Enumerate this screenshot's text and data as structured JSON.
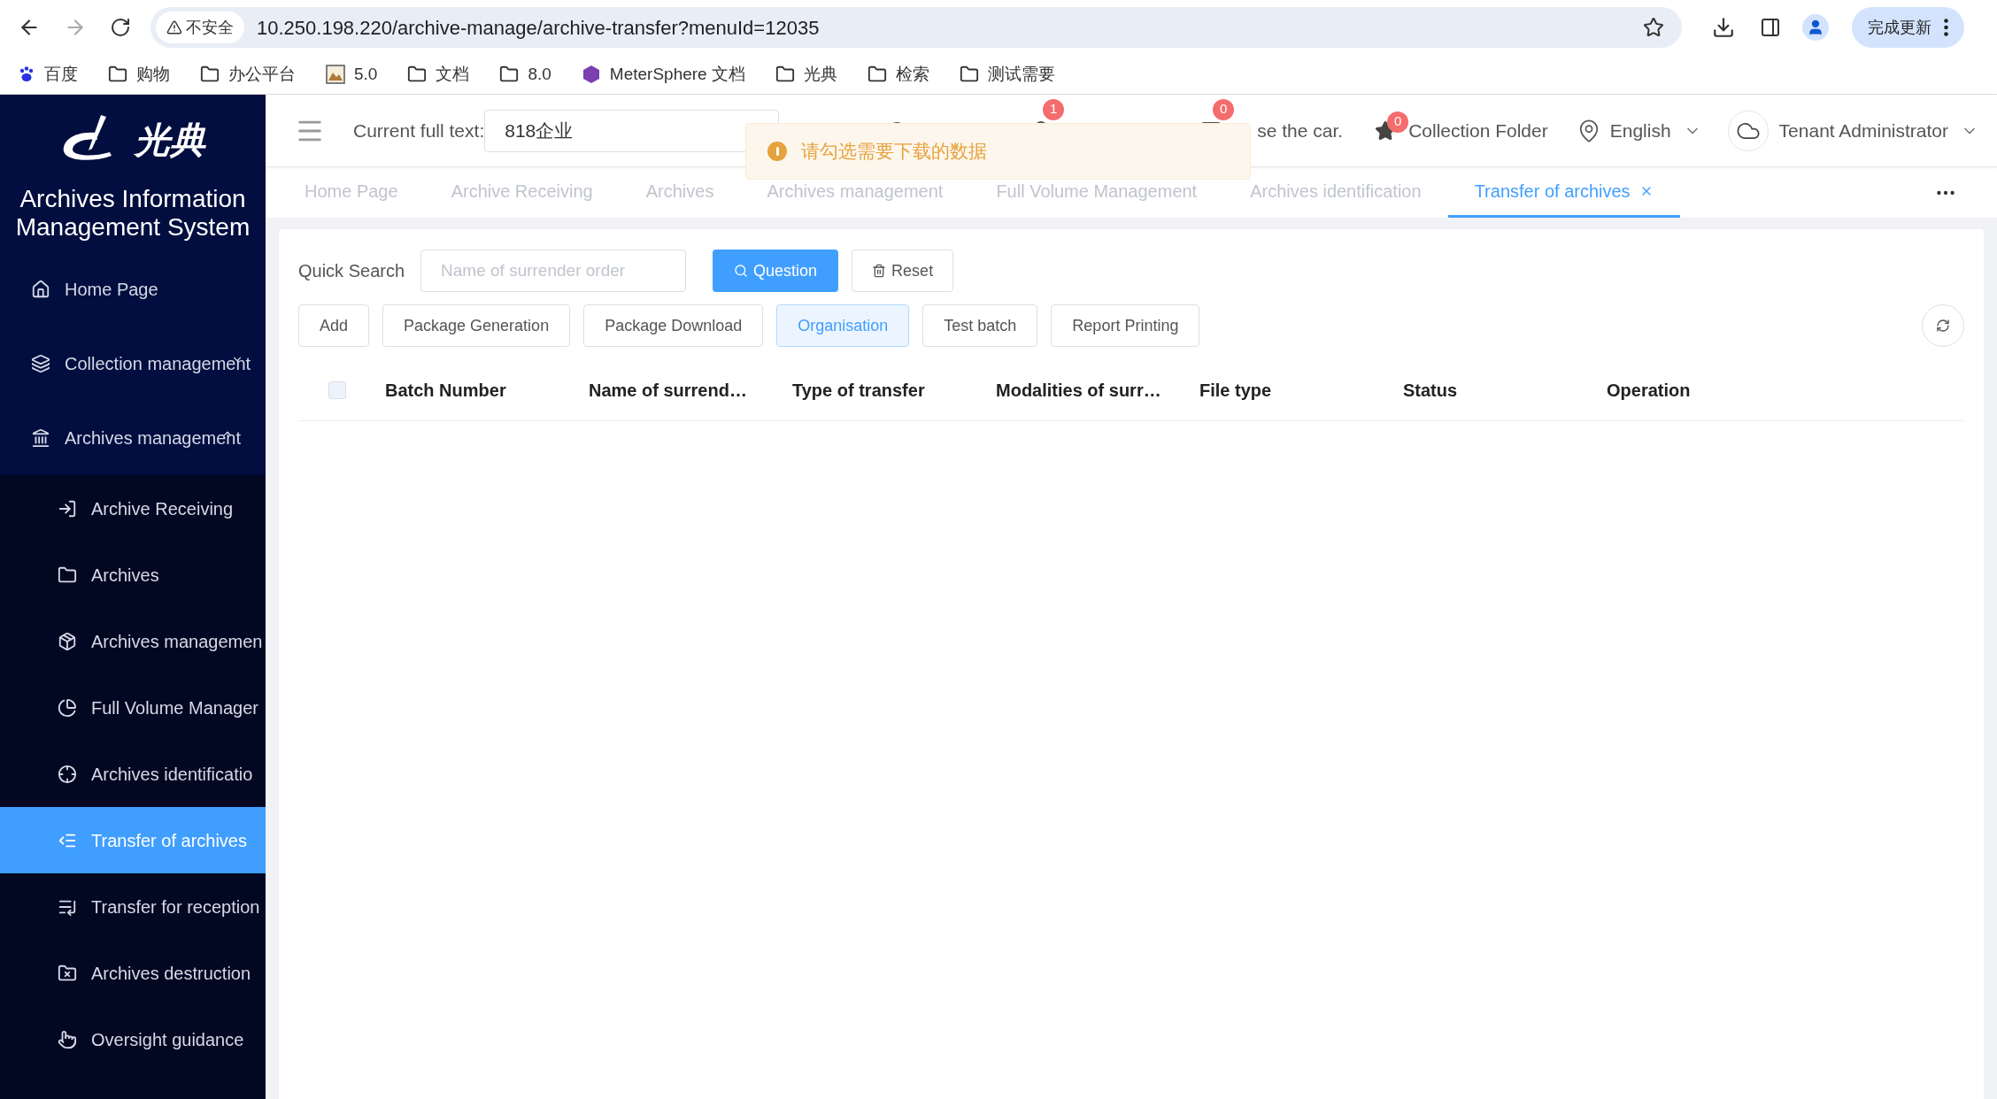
{
  "browser": {
    "security": "不安全",
    "url": "10.250.198.220/archive-manage/archive-transfer?menuId=12035",
    "update_button": "完成更新",
    "bookmarks": [
      {
        "kind": "baidu",
        "label": "百度"
      },
      {
        "kind": "folder",
        "label": "购物"
      },
      {
        "kind": "folder",
        "label": "办公平台"
      },
      {
        "kind": "image",
        "label": "5.0"
      },
      {
        "kind": "folder",
        "label": "文档"
      },
      {
        "kind": "folder",
        "label": "8.0"
      },
      {
        "kind": "app",
        "label": "MeterSphere 文档"
      },
      {
        "kind": "folder",
        "label": "光典"
      },
      {
        "kind": "folder",
        "label": "检索"
      },
      {
        "kind": "folder",
        "label": "测试需要"
      }
    ]
  },
  "sidebar": {
    "logo_text": "光典",
    "title": "Archives Information Management System",
    "items": [
      {
        "label": "Home Page",
        "selected": false
      },
      {
        "label": "Collection management",
        "selected": false,
        "expanded": false
      },
      {
        "label": "Archives management",
        "selected": false,
        "expanded": true,
        "children": [
          {
            "label": "Archive Receiving",
            "selected": false
          },
          {
            "label": "Archives",
            "selected": false
          },
          {
            "label": "Archives managemen",
            "selected": false
          },
          {
            "label": "Full Volume Manager",
            "selected": false
          },
          {
            "label": "Archives identificatio",
            "selected": false
          },
          {
            "label": "Transfer of archives",
            "selected": true
          },
          {
            "label": "Transfer for reception",
            "selected": false
          },
          {
            "label": "Archives destruction",
            "selected": false
          },
          {
            "label": "Oversight guidance",
            "selected": false
          }
        ]
      }
    ]
  },
  "header": {
    "current_label": "Current full text:",
    "current_value": "818企业",
    "badge_1": "1",
    "badge_2": "0",
    "partial_text": "se the car.",
    "collection_badge": "0",
    "collection_label": "Collection Folder",
    "language": "English",
    "user": "Tenant Administrator"
  },
  "toast": {
    "message": "请勾选需要下载的数据"
  },
  "tabs": [
    {
      "label": "Home Page",
      "selected": false
    },
    {
      "label": "Archive Receiving",
      "selected": false
    },
    {
      "label": "Archives",
      "selected": false
    },
    {
      "label": "Archives management",
      "selected": false
    },
    {
      "label": "Full Volume Management",
      "selected": false
    },
    {
      "label": "Archives identification",
      "selected": false
    },
    {
      "label": "Transfer of archives",
      "selected": true
    }
  ],
  "search": {
    "label": "Quick Search",
    "placeholder": "Name of surrender order",
    "search_button": "Question",
    "reset_button": "Reset"
  },
  "toolbar": [
    {
      "label": "Add",
      "selected": false
    },
    {
      "label": "Package Generation",
      "selected": false
    },
    {
      "label": "Package Download",
      "selected": false
    },
    {
      "label": "Organisation",
      "selected": true
    },
    {
      "label": "Test batch",
      "selected": false
    },
    {
      "label": "Report Printing",
      "selected": false
    }
  ],
  "table": {
    "select_all_checked": false,
    "columns": [
      "Batch Number",
      "Name of surrend…",
      "Type of transfer",
      "Modalities of surr…",
      "File type",
      "Status",
      "Operation"
    ]
  }
}
